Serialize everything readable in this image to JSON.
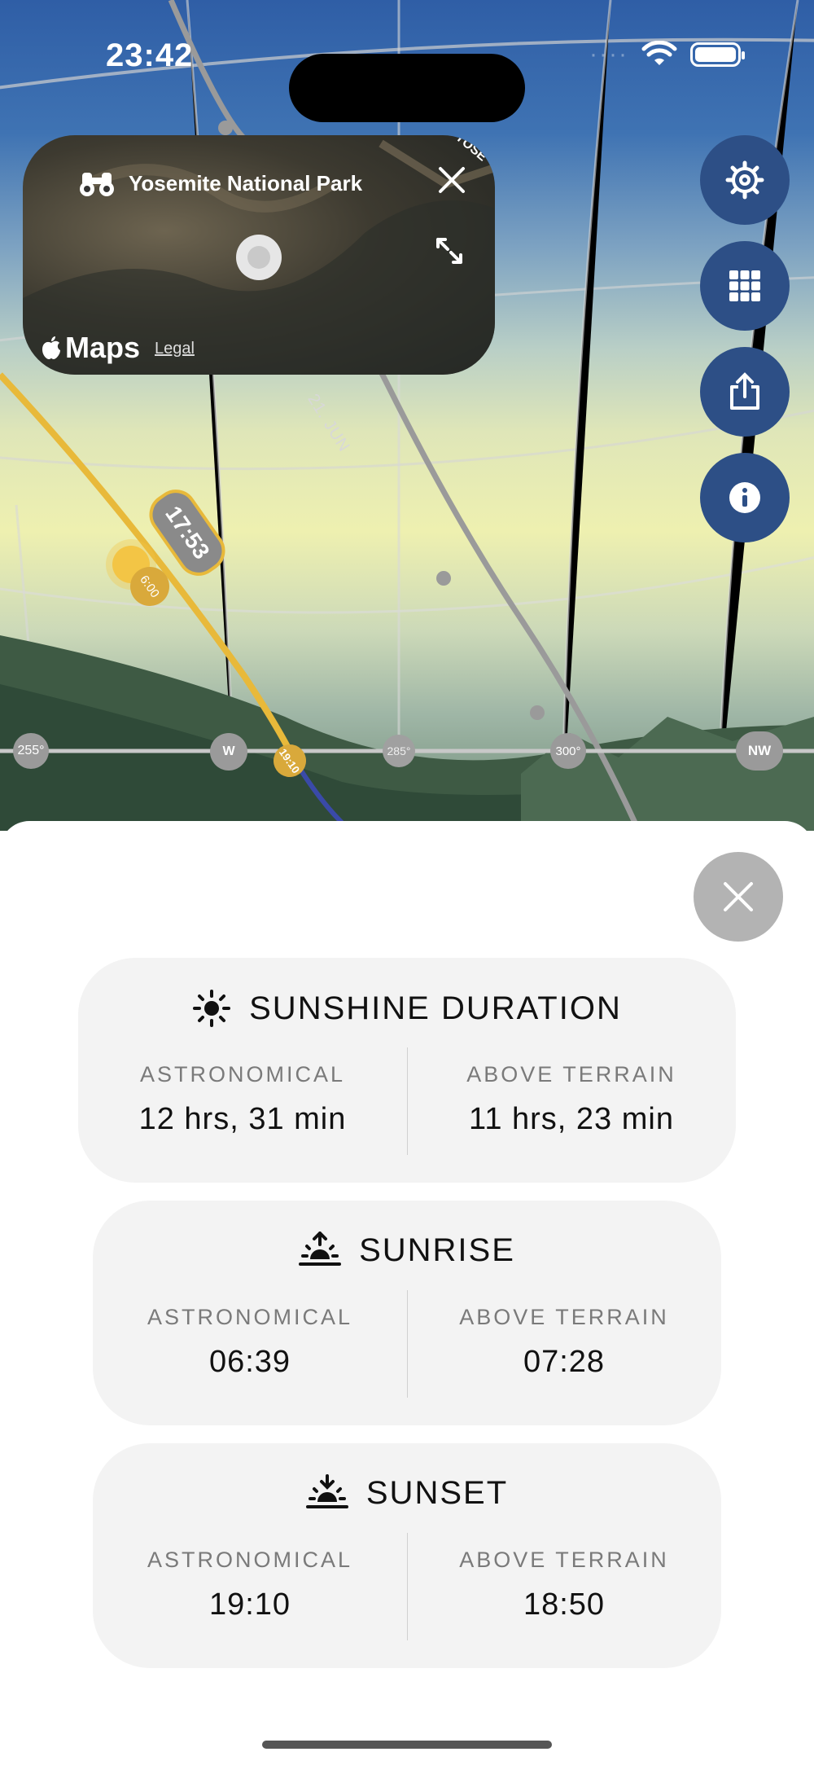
{
  "status_bar": {
    "time": "23:42"
  },
  "map_card": {
    "title": "Yosemite National Park",
    "maps_label": "Maps",
    "legal_label": "Legal"
  },
  "scene": {
    "compass": [
      "255°",
      "W",
      "285°",
      "300°",
      "NW"
    ],
    "time_bubbles": [
      "17:53",
      "6:00",
      "19:10"
    ],
    "date_label": "21. JUN",
    "map_edge_label": "YOSE"
  },
  "side_buttons": [
    "gear-icon",
    "grid-icon",
    "share-icon",
    "info-icon"
  ],
  "cards": [
    {
      "title": "SUNSHINE DURATION",
      "icon": "sun-icon",
      "left": {
        "label": "ASTRONOMICAL",
        "value": "12 hrs, 31 min"
      },
      "right": {
        "label": "ABOVE TERRAIN",
        "value": "11 hrs, 23 min"
      }
    },
    {
      "title": "SUNRISE",
      "icon": "sunrise-icon",
      "left": {
        "label": "ASTRONOMICAL",
        "value": "06:39"
      },
      "right": {
        "label": "ABOVE TERRAIN",
        "value": "07:28"
      }
    },
    {
      "title": "SUNSET",
      "icon": "sunset-icon",
      "left": {
        "label": "ASTRONOMICAL",
        "value": "19:10"
      },
      "right": {
        "label": "ABOVE TERRAIN",
        "value": "18:50"
      }
    }
  ],
  "colors": {
    "sun_path": "#e8b93a",
    "button_bg": "#2d4f86",
    "card_bg": "#f3f3f3"
  }
}
